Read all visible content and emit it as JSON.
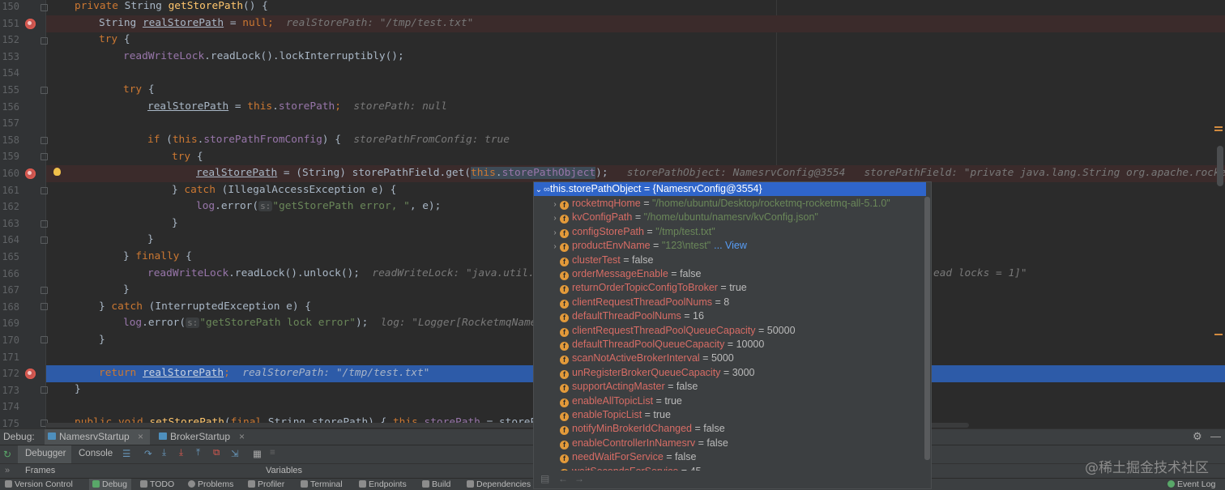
{
  "editor": {
    "line_numbers": [
      "150",
      "151",
      "152",
      "153",
      "154",
      "155",
      "156",
      "157",
      "158",
      "159",
      "160",
      "161",
      "162",
      "163",
      "164",
      "165",
      "166",
      "167",
      "168",
      "169",
      "170",
      "171",
      "172",
      "173",
      "174",
      "175"
    ],
    "lines": {
      "l150": {
        "a": "private ",
        "b": "String ",
        "c": "getStorePath",
        "d": "() {"
      },
      "l151": {
        "a": "String ",
        "b": "realStorePath",
        "c": " = ",
        "d": "null",
        ";": ";",
        "inline": "realStorePath: \"/tmp/test.txt\""
      },
      "l152": {
        "a": "try ",
        "b": "{"
      },
      "l153": {
        "a": "readWriteLock",
        "b": ".readLock().lockInterruptibly();"
      },
      "l155": {
        "a": "try ",
        "b": "{"
      },
      "l156": {
        "a": "realStorePath",
        "b": " = ",
        "c": "this",
        ".": ".",
        "d": "storePath",
        ";": ";",
        "inline": "storePath: null"
      },
      "l158": {
        "a": "if ",
        "b": "(",
        "c": "this",
        ".": ".",
        "d": "storePathFromConfig",
        "e": ") {",
        "inline": "storePathFromConfig: true"
      },
      "l159": {
        "a": "try ",
        "b": "{"
      },
      "l160": {
        "a": "realStorePath",
        "b": " = (String) storePathField.get(",
        "c": "this",
        ".": ".",
        "d": "storePathObject",
        "e": ");",
        "inline1": "storePathObject: NamesrvConfig@3554",
        "inline2": "storePathField: \"private java.lang.String org.apache.rocketmq.c"
      },
      "l161": {
        "a": "} ",
        "b": "catch ",
        "c": "(IllegalAccessException e) {"
      },
      "l162": {
        "a": "log",
        "b": ".error(",
        "hint": "s:",
        "c": "\"getStorePath error, \"",
        ", e);": ", e);"
      },
      "l163": {
        "a": "}"
      },
      "l164": {
        "a": "}"
      },
      "l165": {
        "a": "} ",
        "b": "finally ",
        "c": "{"
      },
      "l166": {
        "a": "readWriteLock",
        "b": ".readLock().unlock();",
        "inline": "readWriteLock: \"java.util.co",
        "inline_right": "ead locks = 1]\""
      },
      "l167": {
        "a": "}"
      },
      "l168": {
        "a": "} ",
        "b": "catch ",
        "c": "(InterruptedException e) {"
      },
      "l169": {
        "a": "log",
        "b": ".error(",
        "hint": "s:",
        "c": "\"getStorePath lock error\"",
        ");": ");",
        "inline": "log: \"Logger[RocketmqNames"
      },
      "l170": {
        "a": "}"
      },
      "l172": {
        "a": "return ",
        "b": "realStorePath",
        ";": ";",
        "inline": "realStorePath: \"/tmp/test.txt\""
      },
      "l173": {
        "a": "}"
      },
      "l175": {
        "a": "public ",
        "b": "void ",
        "c": "setStorePath",
        "d": "(",
        "e": "final ",
        "f": "String storePath) { ",
        "g": "this",
        ".": ".",
        "h": "storePath",
        " = storePat": " = storePat"
      }
    }
  },
  "popup": {
    "header": {
      "name": "this.storePathObject",
      "eq": " = ",
      "value": "{NamesrvConfig@3554}"
    },
    "rows": [
      {
        "name": "rocketmqHome",
        "eq": " = ",
        "value": "\"/home/ubuntu/Desktop/rocketmq-rocketmq-all-5.1.0\"",
        "expandable": true,
        "is_string": true
      },
      {
        "name": "kvConfigPath",
        "eq": " = ",
        "value": "\"/home/ubuntu/namesrv/kvConfig.json\"",
        "expandable": true,
        "is_string": true
      },
      {
        "name": "configStorePath",
        "eq": " = ",
        "value": "\"/tmp/test.txt\"",
        "expandable": true,
        "is_string": true
      },
      {
        "name": "productEnvName",
        "eq": " = ",
        "value": "\"123\\ntest\"",
        "extra": "... View",
        "expandable": true,
        "is_string": true
      },
      {
        "name": "clusterTest",
        "eq": " = ",
        "value": "false"
      },
      {
        "name": "orderMessageEnable",
        "eq": " = ",
        "value": "false"
      },
      {
        "name": "returnOrderTopicConfigToBroker",
        "eq": " = ",
        "value": "true"
      },
      {
        "name": "clientRequestThreadPoolNums",
        "eq": " = ",
        "value": "8"
      },
      {
        "name": "defaultThreadPoolNums",
        "eq": " = ",
        "value": "16"
      },
      {
        "name": "clientRequestThreadPoolQueueCapacity",
        "eq": " = ",
        "value": "50000"
      },
      {
        "name": "defaultThreadPoolQueueCapacity",
        "eq": " = ",
        "value": "10000"
      },
      {
        "name": "scanNotActiveBrokerInterval",
        "eq": " = ",
        "value": "5000"
      },
      {
        "name": "unRegisterBrokerQueueCapacity",
        "eq": " = ",
        "value": "3000"
      },
      {
        "name": "supportActingMaster",
        "eq": " = ",
        "value": "false"
      },
      {
        "name": "enableAllTopicList",
        "eq": " = ",
        "value": "true"
      },
      {
        "name": "enableTopicList",
        "eq": " = ",
        "value": "true"
      },
      {
        "name": "notifyMinBrokerIdChanged",
        "eq": " = ",
        "value": "false"
      },
      {
        "name": "enableControllerInNamesrv",
        "eq": " = ",
        "value": "false"
      },
      {
        "name": "needWaitForService",
        "eq": " = ",
        "value": "false"
      },
      {
        "name": "waitSecondsForService",
        "eq": " = ",
        "value": "45"
      }
    ],
    "field_badge": "f"
  },
  "debug": {
    "label": "Debug:",
    "sessions": [
      "NamesrvStartup",
      "BrokerStartup"
    ],
    "close": "×",
    "tabs": [
      "Debugger",
      "Console"
    ],
    "frames": "Frames",
    "variables": "Variables"
  },
  "statusbar": {
    "items": [
      "Version Control",
      "Debug",
      "TODO",
      "Problems",
      "Profiler",
      "Terminal",
      "Endpoints",
      "Build",
      "Dependencies"
    ],
    "event_log": "Event Log"
  },
  "watermark": "@稀土掘金技术社区",
  "colors": {
    "keyword": "#cc7832",
    "method": "#ffc66d",
    "string": "#6a8759",
    "field": "#9876aa",
    "breakpoint": "#c75450",
    "selection": "#2d5ba8"
  }
}
